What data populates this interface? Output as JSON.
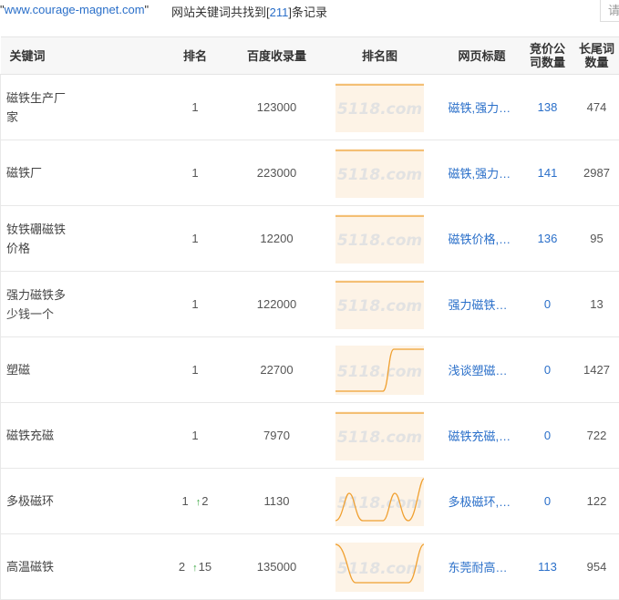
{
  "header": {
    "domain_quoted": "www.courage-magnet.com",
    "summary_prefix": "网站关键词共找到[",
    "summary_count": "211",
    "summary_suffix": "]条记录",
    "search_placeholder": "请"
  },
  "table": {
    "columns": {
      "keyword": "关键词",
      "rank": "排名",
      "baidu_index": "百度收录量",
      "rank_chart": "排名图",
      "page_title": "网页标题",
      "bid_companies_l1": "竞价公",
      "bid_companies_l2": "司数量",
      "longtail_l1": "长尾词",
      "longtail_l2": "数量"
    },
    "watermark": "5118.com",
    "rows": [
      {
        "keyword_l1": "磁铁生产厂",
        "keyword_l2": "家",
        "rank": "1",
        "rank_change": "",
        "indexed": "123000",
        "title": "磁铁,强力磁铁,磁铁厂家",
        "bid": "138",
        "longtail": "474",
        "trend": "flat"
      },
      {
        "keyword_l1": "磁铁厂",
        "keyword_l2": "",
        "rank": "1",
        "rank_change": "",
        "indexed": "223000",
        "title": "磁铁,强力磁铁,磁铁厂家",
        "bid": "141",
        "longtail": "2987",
        "trend": "flat"
      },
      {
        "keyword_l1": "钕铁硼磁铁",
        "keyword_l2": "价格",
        "rank": "1",
        "rank_change": "",
        "indexed": "12200",
        "title": "磁铁价格,钕铁硼磁铁价格",
        "bid": "136",
        "longtail": "95",
        "trend": "flat"
      },
      {
        "keyword_l1": "强力磁铁多",
        "keyword_l2": "少钱一个",
        "rank": "1",
        "rank_change": "",
        "indexed": "122000",
        "title": "强力磁铁多少钱一个",
        "bid": "0",
        "longtail": "13",
        "trend": "flat"
      },
      {
        "keyword_l1": "塑磁",
        "keyword_l2": "",
        "rank": "1",
        "rank_change": "",
        "indexed": "22700",
        "title": "浅谈塑磁的应用",
        "bid": "0",
        "longtail": "1427",
        "trend": "rise"
      },
      {
        "keyword_l1": "磁铁充磁",
        "keyword_l2": "",
        "rank": "1",
        "rank_change": "",
        "indexed": "7970",
        "title": "磁铁充磁,充磁方向",
        "bid": "0",
        "longtail": "722",
        "trend": "flat"
      },
      {
        "keyword_l1": "多极磁环",
        "keyword_l2": "",
        "rank": "1",
        "rank_change": "2",
        "indexed": "1130",
        "title": "多极磁环,多极充磁磁环",
        "bid": "0",
        "longtail": "122",
        "trend": "wave"
      },
      {
        "keyword_l1": "高温磁铁",
        "keyword_l2": "",
        "rank": "2",
        "rank_change": "15",
        "indexed": "135000",
        "title": "东莞耐高温磁铁厂家",
        "bid": "113",
        "longtail": "954",
        "trend": "dip"
      }
    ]
  },
  "colors": {
    "link": "#2a6fc9",
    "chart_line": "#f0a030",
    "chart_fill": "#fdf3e6",
    "arrow_up": "#3aa640"
  }
}
